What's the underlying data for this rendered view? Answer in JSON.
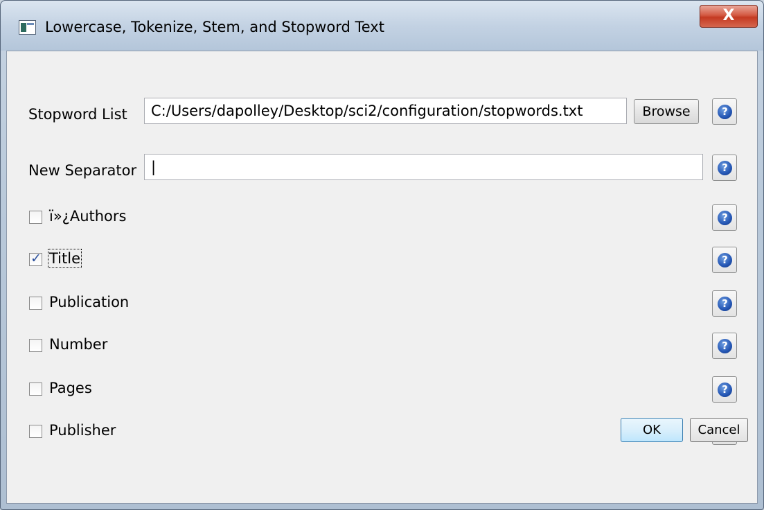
{
  "window": {
    "title": "Lowercase, Tokenize, Stem, and Stopword Text",
    "close_symbol": "X",
    "icon": "app-window-icon",
    "close_icon": "close-icon"
  },
  "stopword_list": {
    "label": "Stopword List",
    "value": "C:/Users/dapolley/Desktop/sci2/configuration/stopwords.txt",
    "browse_label": "Browse"
  },
  "new_separator": {
    "label": "New Separator",
    "value": "|"
  },
  "fields": [
    {
      "label": "ï»¿Authors",
      "checked": false
    },
    {
      "label": "Title",
      "checked": true
    },
    {
      "label": "Publication",
      "checked": false
    },
    {
      "label": "Number",
      "checked": false
    },
    {
      "label": "Pages",
      "checked": false
    },
    {
      "label": "Publisher",
      "checked": false
    }
  ],
  "help_glyph": "?",
  "help_icon": "help-icon",
  "footer": {
    "ok_label": "OK",
    "cancel_label": "Cancel"
  },
  "colors": {
    "close_button": "#c43a22",
    "help_icon": "#2456b4",
    "ok_button_border": "#3c7fb1"
  }
}
